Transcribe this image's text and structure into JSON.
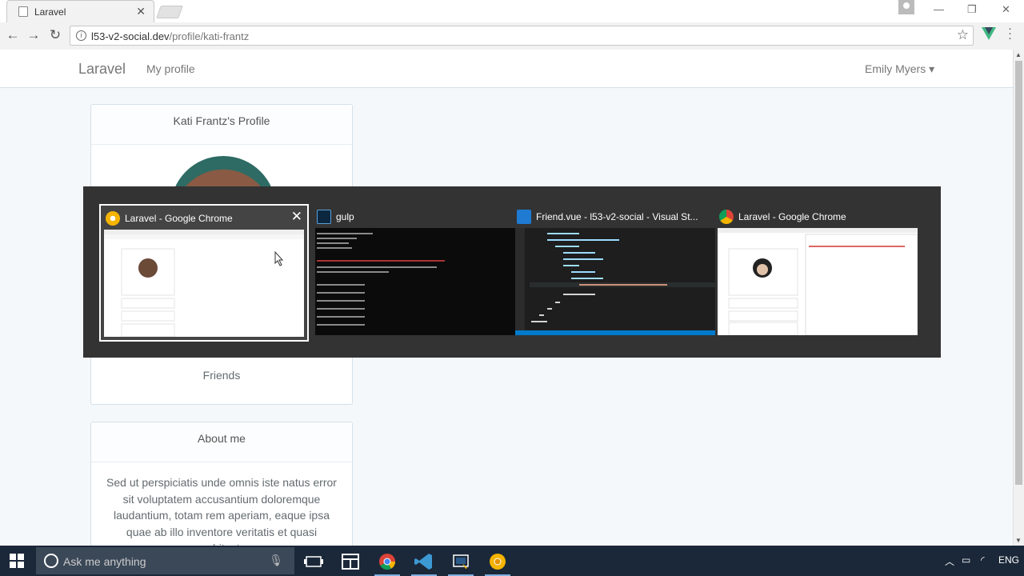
{
  "browser": {
    "tab_title": "Laravel",
    "url_host": "l53-v2-social.dev",
    "url_path": "/profile/kati-frantz"
  },
  "navbar": {
    "brand": "Laravel",
    "links": [
      "My profile"
    ],
    "user": "Emily Myers"
  },
  "profile": {
    "heading": "Kati Frantz's Profile",
    "friends_label": "Friends",
    "about_heading": "About me",
    "about_text": "Sed ut perspiciatis unde omnis iste natus error sit voluptatem accusantium doloremque laudantium, totam rem aperiam, eaque ipsa quae ab illo inventore veritatis et quasi architecto"
  },
  "task_switcher": {
    "windows": [
      {
        "title": "Laravel - Google Chrome",
        "selected": true,
        "icon": "chrome-canary-icon"
      },
      {
        "title": "gulp",
        "selected": false,
        "icon": "terminal-icon"
      },
      {
        "title": "Friend.vue - l53-v2-social - Visual St...",
        "selected": false,
        "icon": "vscode-icon"
      },
      {
        "title": "Laravel - Google Chrome",
        "selected": false,
        "icon": "chrome-icon"
      }
    ]
  },
  "taskbar": {
    "search_placeholder": "Ask me anything",
    "language": "ENG"
  },
  "colors": {
    "taskbar": "#1b2839",
    "switcher_bg": "#333333",
    "page_bg": "#f5f8fa"
  }
}
